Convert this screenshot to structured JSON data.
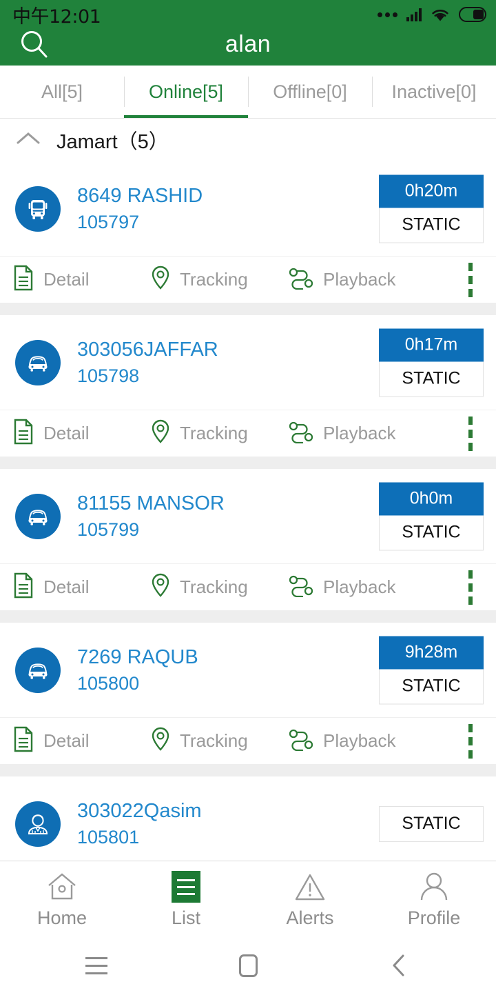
{
  "statusbar": {
    "time": "中午12:01",
    "icons": [
      "more-dots-icon",
      "signal-icon",
      "wifi-icon",
      "battery-icon"
    ]
  },
  "header": {
    "title": "alan",
    "search_icon": "search-icon",
    "background_color": "#20823b"
  },
  "tabs": [
    {
      "label": "All[5]",
      "active": false
    },
    {
      "label": "Online[5]",
      "active": true
    },
    {
      "label": "Offline[0]",
      "active": false
    },
    {
      "label": "Inactive[0]",
      "active": false
    }
  ],
  "group": {
    "collapse_icon": "chevron-up-icon",
    "title": "Jamart（5）"
  },
  "actions": {
    "detail": "Detail",
    "tracking": "Tracking",
    "playback": "Playback",
    "overflow_icon": "kebab-menu-icon"
  },
  "colors": {
    "accent_green": "#20823b",
    "link_blue": "#2288cc",
    "badge_blue": "#0d6fb8",
    "avatar_blue": "#0f6eb4"
  },
  "vehicles": [
    {
      "icon": "bus-icon",
      "name": "8649 RASHID",
      "id": "105797",
      "duration": "0h20m",
      "status": "STATIC"
    },
    {
      "icon": "car-icon",
      "name": "303056JAFFAR",
      "id": "105798",
      "duration": "0h17m",
      "status": "STATIC"
    },
    {
      "icon": "car-icon",
      "name": "81155 MANSOR",
      "id": "105799",
      "duration": "0h0m",
      "status": "STATIC"
    },
    {
      "icon": "car-icon",
      "name": "7269 RAQUB",
      "id": "105800",
      "duration": "9h28m",
      "status": "STATIC"
    },
    {
      "icon": "person-icon",
      "name": "303022Qasim",
      "id": "105801",
      "duration": "",
      "status": "STATIC"
    }
  ],
  "bottom_nav": [
    {
      "label": "Home",
      "icon": "home-icon",
      "active": false
    },
    {
      "label": "List",
      "icon": "list-icon",
      "active": true
    },
    {
      "label": "Alerts",
      "icon": "warning-icon",
      "active": false
    },
    {
      "label": "Profile",
      "icon": "person-icon",
      "active": false
    }
  ],
  "system_nav": [
    "menu-icon",
    "home-square-icon",
    "back-chevron-icon"
  ]
}
